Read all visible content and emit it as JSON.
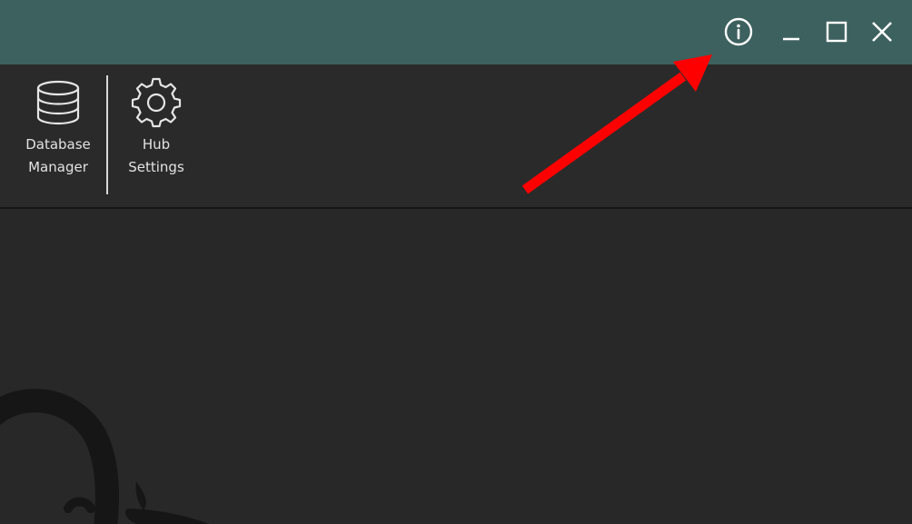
{
  "titlebar": {
    "buttons": [
      {
        "name": "info",
        "icon": "info-icon"
      },
      {
        "name": "minimize",
        "icon": "minimize-icon"
      },
      {
        "name": "maximize",
        "icon": "maximize-icon"
      },
      {
        "name": "close",
        "icon": "close-icon"
      }
    ],
    "color": "#3d615e"
  },
  "toolbar": {
    "items": [
      {
        "icon": "database-icon",
        "line1": "Database",
        "line2": "Manager"
      },
      {
        "icon": "gear-icon",
        "line1": "Hub",
        "line2": "Settings"
      }
    ]
  },
  "annotation": {
    "arrow_color": "#ff0000",
    "target": "info-button"
  },
  "background": {
    "logo": "watermark-logo"
  },
  "colors": {
    "background": "#282828",
    "text": "#e2e2e2"
  }
}
